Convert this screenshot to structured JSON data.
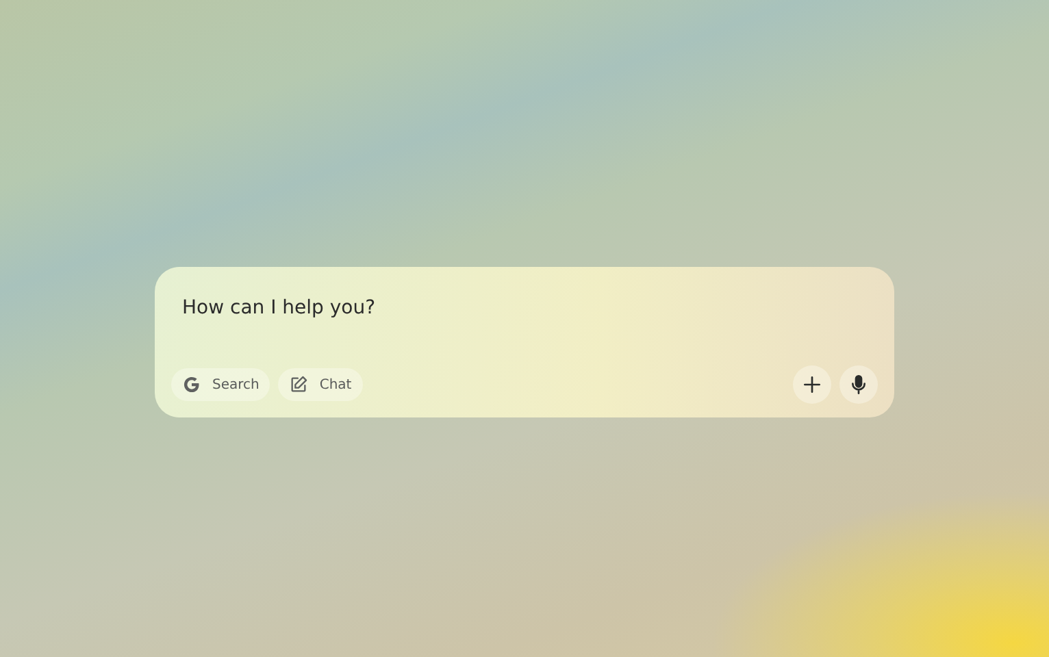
{
  "prompt_box": {
    "placeholder": "How can I help you?",
    "modes": [
      {
        "kind": "search",
        "label": "Search"
      },
      {
        "kind": "chat",
        "label": "Chat"
      }
    ],
    "actions": [
      {
        "kind": "add"
      },
      {
        "kind": "voice"
      }
    ]
  }
}
